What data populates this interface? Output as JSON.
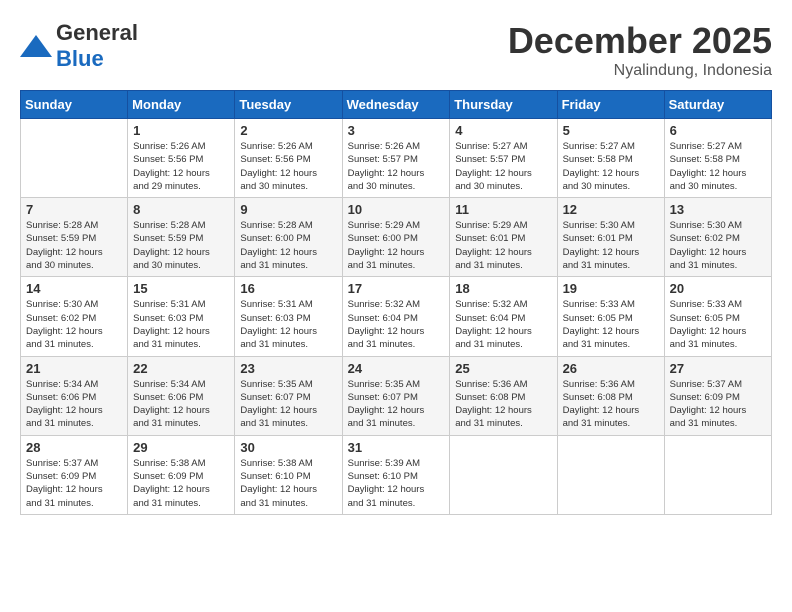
{
  "header": {
    "logo_general": "General",
    "logo_blue": "Blue",
    "month_title": "December 2025",
    "location": "Nyalindung, Indonesia"
  },
  "weekdays": [
    "Sunday",
    "Monday",
    "Tuesday",
    "Wednesday",
    "Thursday",
    "Friday",
    "Saturday"
  ],
  "weeks": [
    [
      {
        "day": "",
        "info": ""
      },
      {
        "day": "1",
        "info": "Sunrise: 5:26 AM\nSunset: 5:56 PM\nDaylight: 12 hours\nand 29 minutes."
      },
      {
        "day": "2",
        "info": "Sunrise: 5:26 AM\nSunset: 5:56 PM\nDaylight: 12 hours\nand 30 minutes."
      },
      {
        "day": "3",
        "info": "Sunrise: 5:26 AM\nSunset: 5:57 PM\nDaylight: 12 hours\nand 30 minutes."
      },
      {
        "day": "4",
        "info": "Sunrise: 5:27 AM\nSunset: 5:57 PM\nDaylight: 12 hours\nand 30 minutes."
      },
      {
        "day": "5",
        "info": "Sunrise: 5:27 AM\nSunset: 5:58 PM\nDaylight: 12 hours\nand 30 minutes."
      },
      {
        "day": "6",
        "info": "Sunrise: 5:27 AM\nSunset: 5:58 PM\nDaylight: 12 hours\nand 30 minutes."
      }
    ],
    [
      {
        "day": "7",
        "info": "Sunrise: 5:28 AM\nSunset: 5:59 PM\nDaylight: 12 hours\nand 30 minutes."
      },
      {
        "day": "8",
        "info": "Sunrise: 5:28 AM\nSunset: 5:59 PM\nDaylight: 12 hours\nand 30 minutes."
      },
      {
        "day": "9",
        "info": "Sunrise: 5:28 AM\nSunset: 6:00 PM\nDaylight: 12 hours\nand 31 minutes."
      },
      {
        "day": "10",
        "info": "Sunrise: 5:29 AM\nSunset: 6:00 PM\nDaylight: 12 hours\nand 31 minutes."
      },
      {
        "day": "11",
        "info": "Sunrise: 5:29 AM\nSunset: 6:01 PM\nDaylight: 12 hours\nand 31 minutes."
      },
      {
        "day": "12",
        "info": "Sunrise: 5:30 AM\nSunset: 6:01 PM\nDaylight: 12 hours\nand 31 minutes."
      },
      {
        "day": "13",
        "info": "Sunrise: 5:30 AM\nSunset: 6:02 PM\nDaylight: 12 hours\nand 31 minutes."
      }
    ],
    [
      {
        "day": "14",
        "info": "Sunrise: 5:30 AM\nSunset: 6:02 PM\nDaylight: 12 hours\nand 31 minutes."
      },
      {
        "day": "15",
        "info": "Sunrise: 5:31 AM\nSunset: 6:03 PM\nDaylight: 12 hours\nand 31 minutes."
      },
      {
        "day": "16",
        "info": "Sunrise: 5:31 AM\nSunset: 6:03 PM\nDaylight: 12 hours\nand 31 minutes."
      },
      {
        "day": "17",
        "info": "Sunrise: 5:32 AM\nSunset: 6:04 PM\nDaylight: 12 hours\nand 31 minutes."
      },
      {
        "day": "18",
        "info": "Sunrise: 5:32 AM\nSunset: 6:04 PM\nDaylight: 12 hours\nand 31 minutes."
      },
      {
        "day": "19",
        "info": "Sunrise: 5:33 AM\nSunset: 6:05 PM\nDaylight: 12 hours\nand 31 minutes."
      },
      {
        "day": "20",
        "info": "Sunrise: 5:33 AM\nSunset: 6:05 PM\nDaylight: 12 hours\nand 31 minutes."
      }
    ],
    [
      {
        "day": "21",
        "info": "Sunrise: 5:34 AM\nSunset: 6:06 PM\nDaylight: 12 hours\nand 31 minutes."
      },
      {
        "day": "22",
        "info": "Sunrise: 5:34 AM\nSunset: 6:06 PM\nDaylight: 12 hours\nand 31 minutes."
      },
      {
        "day": "23",
        "info": "Sunrise: 5:35 AM\nSunset: 6:07 PM\nDaylight: 12 hours\nand 31 minutes."
      },
      {
        "day": "24",
        "info": "Sunrise: 5:35 AM\nSunset: 6:07 PM\nDaylight: 12 hours\nand 31 minutes."
      },
      {
        "day": "25",
        "info": "Sunrise: 5:36 AM\nSunset: 6:08 PM\nDaylight: 12 hours\nand 31 minutes."
      },
      {
        "day": "26",
        "info": "Sunrise: 5:36 AM\nSunset: 6:08 PM\nDaylight: 12 hours\nand 31 minutes."
      },
      {
        "day": "27",
        "info": "Sunrise: 5:37 AM\nSunset: 6:09 PM\nDaylight: 12 hours\nand 31 minutes."
      }
    ],
    [
      {
        "day": "28",
        "info": "Sunrise: 5:37 AM\nSunset: 6:09 PM\nDaylight: 12 hours\nand 31 minutes."
      },
      {
        "day": "29",
        "info": "Sunrise: 5:38 AM\nSunset: 6:09 PM\nDaylight: 12 hours\nand 31 minutes."
      },
      {
        "day": "30",
        "info": "Sunrise: 5:38 AM\nSunset: 6:10 PM\nDaylight: 12 hours\nand 31 minutes."
      },
      {
        "day": "31",
        "info": "Sunrise: 5:39 AM\nSunset: 6:10 PM\nDaylight: 12 hours\nand 31 minutes."
      },
      {
        "day": "",
        "info": ""
      },
      {
        "day": "",
        "info": ""
      },
      {
        "day": "",
        "info": ""
      }
    ]
  ]
}
